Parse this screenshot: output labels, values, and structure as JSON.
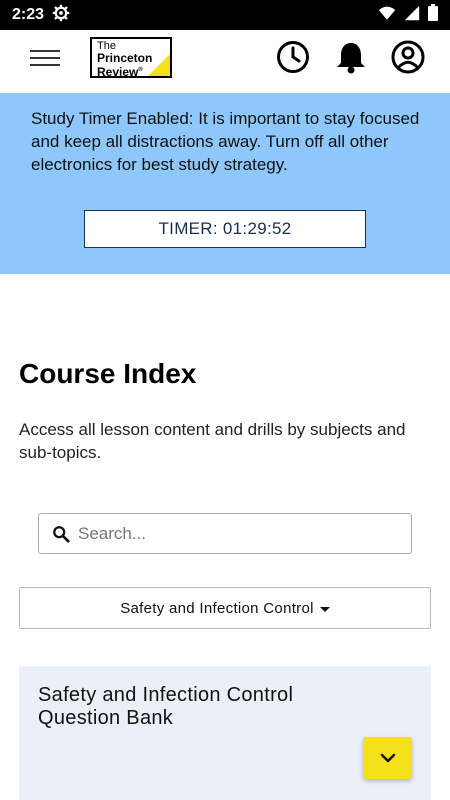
{
  "status_bar": {
    "time": "2:23",
    "icons": [
      "settings-gear-icon",
      "wifi-icon",
      "cellular-signal-icon",
      "battery-icon"
    ]
  },
  "header": {
    "logo_line1": "The",
    "logo_line2": "Princeton",
    "logo_line3": "Review",
    "logo_mark": "®",
    "icons": [
      "menu-icon",
      "clock-icon",
      "bell-icon",
      "account-icon"
    ],
    "accent_color": "#f5e11a"
  },
  "timer_banner": {
    "message": "Study Timer Enabled: It is important to stay focused and keep all distractions away. Turn off all other electronics for best study strategy.",
    "timer_label": "TIMER: 01:29:52",
    "background_color": "#8dc7fb"
  },
  "course_index": {
    "title": "Course Index",
    "description": "Access all lesson content and drills by subjects and sub-topics."
  },
  "search": {
    "placeholder": "Search...",
    "value": ""
  },
  "subject_select": {
    "selected": "Safety and Infection Control"
  },
  "question_bank": {
    "title": "Safety and Infection Control Question Bank"
  },
  "expand_button": {
    "icon": "chevron-down-icon"
  }
}
